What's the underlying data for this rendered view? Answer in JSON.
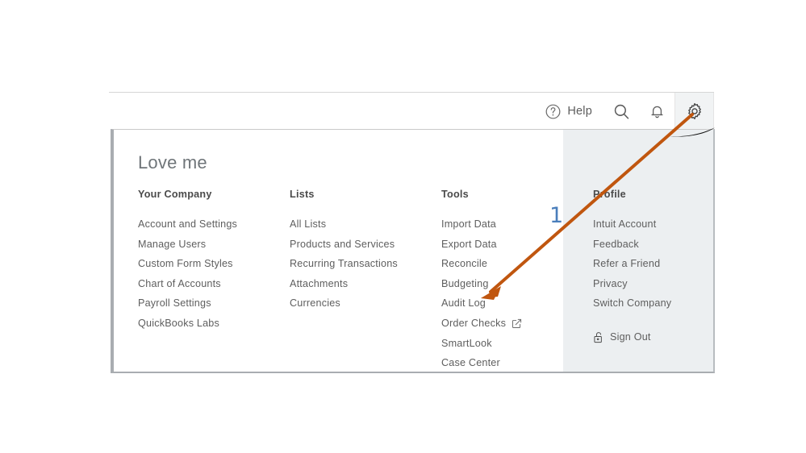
{
  "header": {
    "help_label": "Help",
    "icons": [
      {
        "name": "help-circle-icon",
        "label": "Help"
      },
      {
        "name": "search-icon",
        "label": "Search"
      },
      {
        "name": "notifications-bell-icon",
        "label": "Notifications"
      },
      {
        "name": "gear-icon",
        "label": "Settings"
      }
    ]
  },
  "panel": {
    "title": "Love me",
    "columns": [
      {
        "heading": "Your Company",
        "items": [
          {
            "label": "Account and Settings"
          },
          {
            "label": "Manage Users"
          },
          {
            "label": "Custom Form Styles"
          },
          {
            "label": "Chart of Accounts"
          },
          {
            "label": "Payroll Settings"
          },
          {
            "label": "QuickBooks Labs"
          }
        ]
      },
      {
        "heading": "Lists",
        "items": [
          {
            "label": "All Lists"
          },
          {
            "label": "Products and Services"
          },
          {
            "label": "Recurring Transactions"
          },
          {
            "label": "Attachments"
          },
          {
            "label": "Currencies"
          }
        ]
      },
      {
        "heading": "Tools",
        "items": [
          {
            "label": "Import Data"
          },
          {
            "label": "Export Data"
          },
          {
            "label": "Reconcile"
          },
          {
            "label": "Budgeting"
          },
          {
            "label": "Audit Log"
          },
          {
            "label": "Order Checks",
            "external": true
          },
          {
            "label": "SmartLook"
          },
          {
            "label": "Case Center"
          }
        ]
      },
      {
        "heading": "Profile",
        "items": [
          {
            "label": "Intuit Account"
          },
          {
            "label": "Feedback"
          },
          {
            "label": "Refer a Friend"
          },
          {
            "label": "Privacy"
          },
          {
            "label": "Switch Company"
          }
        ],
        "sign_out": "Sign Out"
      }
    ]
  },
  "annotation": {
    "number": "1",
    "arrow_color": "#c0560f",
    "number_color": "#4a7ebb"
  },
  "colors": {
    "panel_shade": "#eceff1",
    "gear_tab": "#f1f3f4",
    "text": "#5e5e5e",
    "heading": "#4a4a4a",
    "title": "#6f7579"
  }
}
